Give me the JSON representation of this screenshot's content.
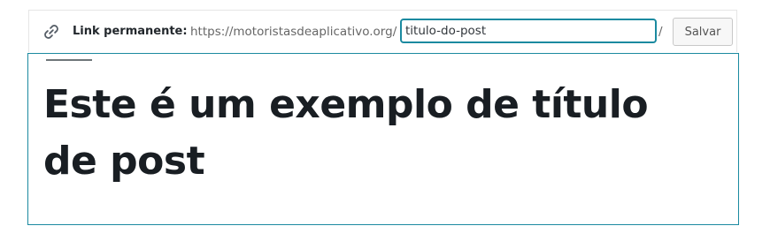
{
  "permalink": {
    "icon": "link-icon",
    "label": "Link permanente:",
    "base_url": "https://motoristasdeaplicativo.org/",
    "slug_value": "titulo-do-post",
    "trailing_slash": "/",
    "save_label": "Salvar"
  },
  "post": {
    "title": "Este é um exemplo de título de post"
  },
  "colors": {
    "focus_border": "#1b8aa0",
    "title_text": "#191e23",
    "label_text": "#23282d",
    "url_text": "#666666"
  }
}
